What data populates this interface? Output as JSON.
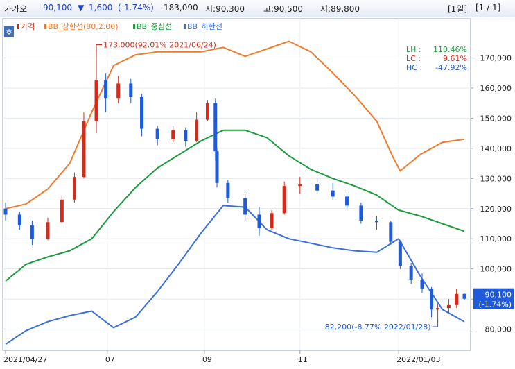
{
  "header": {
    "stock_name": "카카오",
    "price": "90,100",
    "change_arrow": "▼",
    "change": "1,600",
    "change_pct": "(-1.74%)",
    "volume": "183,090",
    "open": "시:90,300",
    "high": "고:90,500",
    "low": "저:89,800",
    "period": "[1일]",
    "page": "[1 / 1]"
  },
  "colors": {
    "price_up": "#d62a1a",
    "price_down": "#1f5bd8",
    "bb_upper": "#f07a2c",
    "bb_middle": "#1a9b3c",
    "bb_lower": "#3a6fe0",
    "current_box": "#1f5bd8"
  },
  "chart_data": {
    "type": "candlestick",
    "title": "",
    "legend": {
      "tag": "호",
      "items": [
        {
          "label": "가격",
          "color": "#d62a1a"
        },
        {
          "label": "BB_상한선(80,2.00)",
          "color": "#f07a2c"
        },
        {
          "label": "BB_중심선",
          "color": "#1a9b3c"
        },
        {
          "label": "BB_하한선",
          "color": "#3a6fe0"
        }
      ]
    },
    "ylim": [
      73000,
      183000
    ],
    "y_ticks": [
      "80,000",
      "90,000",
      "100,000",
      "110,000",
      "120,000",
      "130,000",
      "140,000",
      "150,000",
      "160,000",
      "170,000"
    ],
    "y_tick_values": [
      80000,
      90000,
      100000,
      110000,
      120000,
      130000,
      140000,
      150000,
      160000,
      170000
    ],
    "x_ticks": [
      "2021/04/27",
      "07",
      "09",
      "11",
      "2022/01/03"
    ],
    "x_tick_dates": [
      "2021-04-27",
      "2021-07-01",
      "2021-09-01",
      "2021-11-01",
      "2022-01-03"
    ],
    "x_range": [
      "2021-04-27",
      "2022-02-14"
    ],
    "series": [
      {
        "name": "BB_상한선(80,2.00)",
        "x": [
          "2021-04-27",
          "2021-05-10",
          "2021-05-24",
          "2021-06-07",
          "2021-06-21",
          "2021-07-05",
          "2021-07-19",
          "2021-08-02",
          "2021-08-16",
          "2021-08-30",
          "2021-09-13",
          "2021-09-27",
          "2021-10-11",
          "2021-10-25",
          "2021-11-08",
          "2021-11-22",
          "2021-12-06",
          "2021-12-20",
          "2021-12-30",
          "2022-01-04",
          "2022-01-17",
          "2022-01-31",
          "2022-02-14"
        ],
        "values": [
          120000,
          121500,
          126500,
          135000,
          152000,
          167500,
          171000,
          172000,
          172000,
          172000,
          173500,
          170500,
          173000,
          175500,
          172000,
          165000,
          157500,
          149000,
          137500,
          132500,
          138000,
          142000,
          143000
        ]
      },
      {
        "name": "BB_중심선",
        "x": [
          "2021-04-27",
          "2021-05-10",
          "2021-05-24",
          "2021-06-07",
          "2021-06-21",
          "2021-07-05",
          "2021-07-19",
          "2021-08-02",
          "2021-08-16",
          "2021-08-30",
          "2021-09-13",
          "2021-09-27",
          "2021-10-11",
          "2021-10-25",
          "2021-11-08",
          "2021-11-22",
          "2021-12-06",
          "2021-12-20",
          "2022-01-03",
          "2022-01-17",
          "2022-01-31",
          "2022-02-14"
        ],
        "values": [
          96000,
          101500,
          104000,
          106000,
          110000,
          119000,
          127000,
          133500,
          138000,
          142500,
          146000,
          146000,
          143500,
          137500,
          133000,
          130000,
          127500,
          124500,
          119500,
          117500,
          115000,
          112500
        ]
      },
      {
        "name": "BB_하한선",
        "x": [
          "2021-04-27",
          "2021-05-10",
          "2021-05-24",
          "2021-06-07",
          "2021-06-21",
          "2021-07-05",
          "2021-07-19",
          "2021-08-02",
          "2021-08-16",
          "2021-08-30",
          "2021-09-13",
          "2021-09-27",
          "2021-10-11",
          "2021-10-25",
          "2021-11-08",
          "2021-11-22",
          "2021-12-06",
          "2021-12-20",
          "2022-01-03",
          "2022-01-17",
          "2022-01-31",
          "2022-02-14"
        ],
        "values": [
          75000,
          79500,
          82500,
          84500,
          86000,
          80500,
          84000,
          92500,
          102000,
          112000,
          121000,
          120500,
          113000,
          110000,
          108500,
          107000,
          106000,
          105500,
          110000,
          97500,
          86500,
          82500
        ]
      },
      {
        "name": "가격",
        "ohlc": [
          [
            "2021-04-27",
            120000,
            122000,
            116000,
            118000
          ],
          [
            "2021-05-06",
            118000,
            119000,
            113000,
            114500
          ],
          [
            "2021-05-14",
            114500,
            116000,
            108000,
            110000
          ],
          [
            "2021-05-24",
            110000,
            117000,
            109500,
            115500
          ],
          [
            "2021-06-02",
            115500,
            124500,
            115000,
            123000
          ],
          [
            "2021-06-10",
            123000,
            132000,
            122000,
            130500
          ],
          [
            "2021-06-16",
            130500,
            152000,
            130000,
            149000
          ],
          [
            "2021-06-24",
            149000,
            173000,
            145000,
            162500
          ],
          [
            "2021-06-30",
            162500,
            165000,
            152000,
            156500
          ],
          [
            "2021-07-08",
            156500,
            164000,
            155000,
            161500
          ],
          [
            "2021-07-16",
            161500,
            163000,
            155000,
            157000
          ],
          [
            "2021-07-23",
            157000,
            158000,
            144000,
            146500
          ],
          [
            "2021-08-02",
            146500,
            147500,
            141000,
            143000
          ],
          [
            "2021-08-12",
            143000,
            147500,
            142000,
            146000
          ],
          [
            "2021-08-20",
            146000,
            147000,
            140500,
            142500
          ],
          [
            "2021-08-27",
            142500,
            152000,
            142000,
            149500
          ],
          [
            "2021-09-03",
            149500,
            156000,
            149000,
            155000
          ],
          [
            "2021-09-08",
            155000,
            156500,
            136000,
            139000
          ],
          [
            "2021-09-09",
            139000,
            140000,
            127000,
            128500
          ],
          [
            "2021-09-16",
            128500,
            129500,
            122000,
            123500
          ],
          [
            "2021-09-27",
            123500,
            125000,
            116000,
            118000
          ],
          [
            "2021-10-06",
            118000,
            120500,
            111000,
            113500
          ],
          [
            "2021-10-14",
            113500,
            119500,
            113000,
            118500
          ],
          [
            "2021-10-22",
            118500,
            129000,
            118000,
            127500
          ],
          [
            "2021-11-01",
            127500,
            130500,
            125000,
            128000
          ],
          [
            "2021-11-12",
            128000,
            130000,
            125000,
            126000
          ],
          [
            "2021-11-22",
            126000,
            128500,
            123000,
            124000
          ],
          [
            "2021-12-01",
            124000,
            125000,
            120000,
            121000
          ],
          [
            "2021-12-10",
            121000,
            122000,
            115000,
            116000
          ],
          [
            "2021-12-20",
            116000,
            117500,
            113000,
            115500
          ],
          [
            "2021-12-29",
            115500,
            116000,
            108000,
            109000
          ],
          [
            "2022-01-04",
            109000,
            109500,
            100000,
            101000
          ],
          [
            "2022-01-11",
            101000,
            102000,
            95000,
            96500
          ],
          [
            "2022-01-18",
            96500,
            98500,
            92000,
            93500
          ],
          [
            "2022-01-24",
            93500,
            94000,
            84000,
            86500
          ],
          [
            "2022-01-28",
            86500,
            88500,
            82200,
            87000
          ],
          [
            "2022-02-04",
            87000,
            90000,
            85500,
            88000
          ],
          [
            "2022-02-09",
            88000,
            93500,
            87000,
            91700
          ],
          [
            "2022-02-14",
            91700,
            91800,
            89800,
            90100
          ]
        ]
      }
    ],
    "annotations": [
      {
        "text": "173,000(92.01% 2021/06/24)",
        "date": "2021-06-24",
        "value": 173000
      },
      {
        "text": "82,200(-8.77% 2022/01/28)",
        "date": "2022-01-28",
        "value": 82200
      }
    ],
    "stats": [
      {
        "label": "LH :",
        "value": "110.46%",
        "color": "#1a9b3c"
      },
      {
        "label": "LC :",
        "value": "9.61%",
        "color": "#d62a1a"
      },
      {
        "label": "HC :",
        "value": "-47.92%",
        "color": "#1f5bd8"
      }
    ],
    "current": {
      "price": "90,100",
      "pct": "(-1.74%)",
      "value": 90100
    }
  }
}
